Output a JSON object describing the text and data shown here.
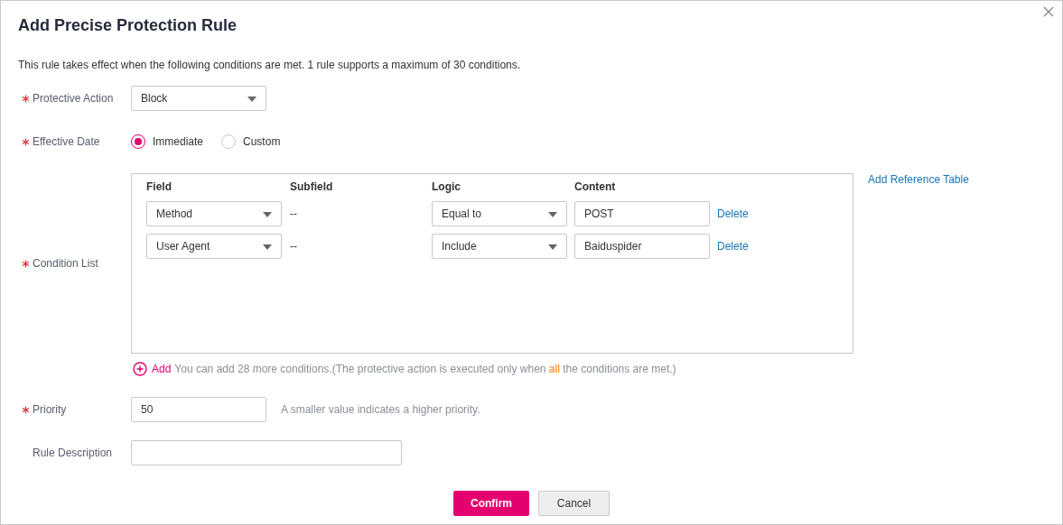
{
  "dialog": {
    "title": "Add Precise Protection Rule",
    "description": "This rule takes effect when the following conditions are met. 1 rule supports a maximum of 30 conditions."
  },
  "fields": [
    {
      "kind": "select",
      "label": "Protective Action",
      "required": true,
      "value": "Block"
    },
    {
      "kind": "radio",
      "label": "Effective Date",
      "required": true,
      "options": [
        {
          "label": "Immediate",
          "selected": true
        },
        {
          "label": "Custom",
          "selected": false
        }
      ]
    },
    {
      "kind": "conditions",
      "label": "Condition List",
      "required": true,
      "columns": [
        "Field",
        "Subfield",
        "Logic",
        "Content"
      ],
      "rows": [
        {
          "field": "Method",
          "subfield": "--",
          "logic": "Equal to",
          "content": "POST",
          "action": "Delete"
        },
        {
          "field": "User Agent",
          "subfield": "--",
          "logic": "Include",
          "content": "Baiduspider",
          "action": "Delete"
        }
      ],
      "side_link": "Add Reference Table",
      "add_label": "Add",
      "add_hint_before": "You can add 28 more conditions.(The protective action is executed only when ",
      "add_hint_highlight": "all",
      "add_hint_after": " the conditions are met.)"
    },
    {
      "kind": "input",
      "label": "Priority",
      "required": true,
      "value": "50",
      "hint": "A smaller value indicates a higher priority."
    },
    {
      "kind": "text",
      "label": "Rule Description",
      "required": false
    }
  ],
  "buttons": [
    {
      "label": "Confirm",
      "kind": "primary"
    },
    {
      "label": "Cancel",
      "kind": "secondary"
    }
  ]
}
